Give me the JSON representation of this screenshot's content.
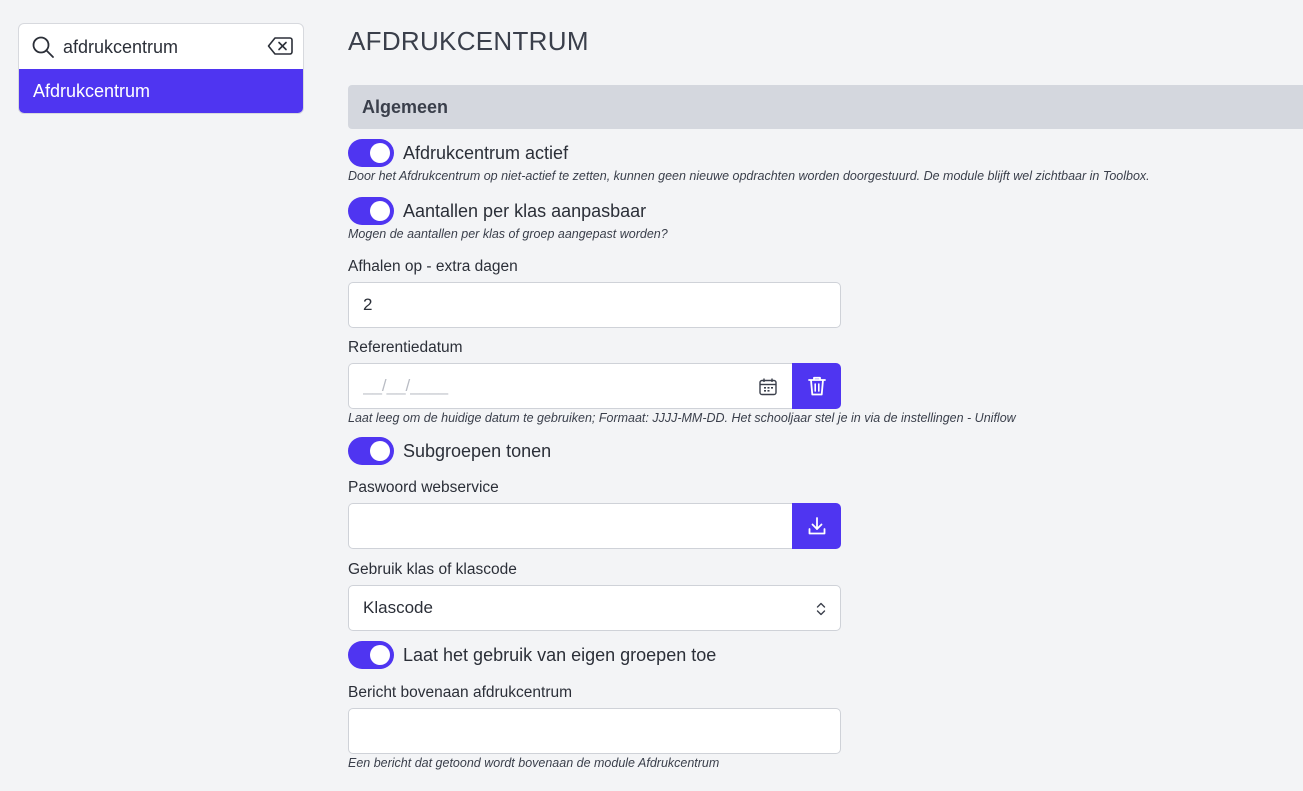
{
  "sidebar": {
    "search": {
      "value": "afdrukcentrum",
      "icon": "search-icon",
      "clear_icon": "backspace-clear-icon"
    },
    "results": [
      {
        "label": "Afdrukcentrum",
        "selected": true
      }
    ]
  },
  "page": {
    "title": "AFDRUKCENTRUM",
    "section": "Algemeen"
  },
  "fields": {
    "active": {
      "label": "Afdrukcentrum actief",
      "enabled": true,
      "help": "Door het Afdrukcentrum op niet-actief te zetten, kunnen geen nieuwe opdrachten worden doorgestuurd. De module blijft wel zichtbaar in Toolbox."
    },
    "counts_editable": {
      "label": "Aantallen per klas aanpasbaar",
      "enabled": true,
      "help": "Mogen de aantallen per klas of groep aangepast worden?"
    },
    "pickup_days": {
      "label": "Afhalen op - extra dagen",
      "value": "2"
    },
    "reference_date": {
      "label": "Referentiedatum",
      "placeholder": "__/__/____",
      "value": "",
      "help": "Laat leeg om de huidige datum te gebruiken; Formaat: JJJJ-MM-DD. Het schooljaar stel je in via de instellingen - Uniflow"
    },
    "subgroups": {
      "label": "Subgroepen tonen",
      "enabled": true
    },
    "password": {
      "label": "Paswoord webservice",
      "value": ""
    },
    "class_mode": {
      "label": "Gebruik klas of klascode",
      "selected": "Klascode"
    },
    "own_groups": {
      "label": "Laat het gebruik van eigen groepen toe",
      "enabled": true
    },
    "top_message": {
      "label": "Bericht bovenaan afdrukcentrum",
      "value": "",
      "help": "Een bericht dat getoond wordt bovenaan de module Afdrukcentrum"
    }
  },
  "colors": {
    "accent": "#4f35f1",
    "section_bg": "#d4d7de",
    "page_bg": "#f3f4f6"
  }
}
